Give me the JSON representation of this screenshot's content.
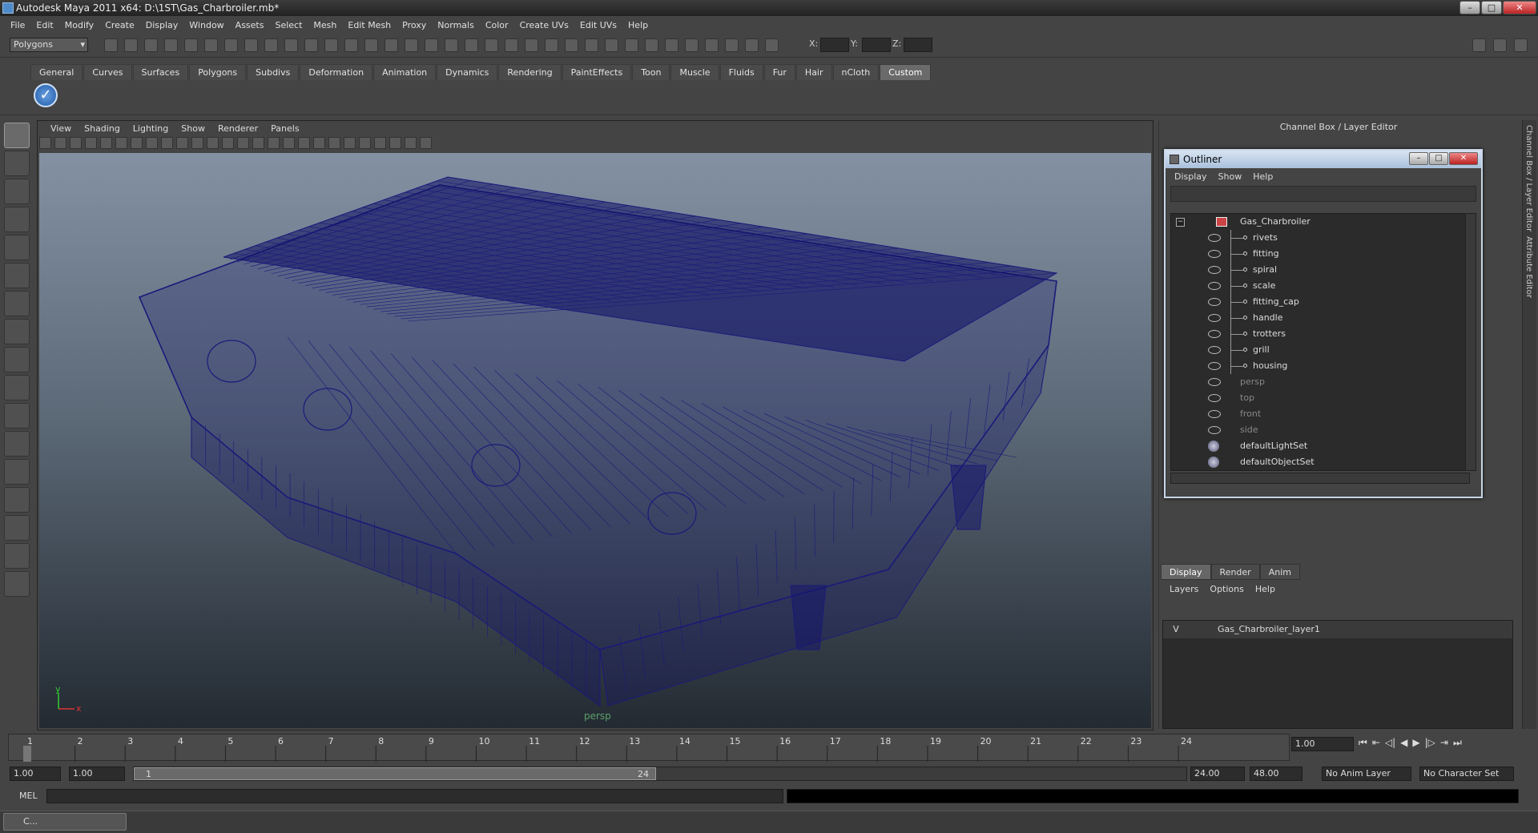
{
  "window": {
    "title": "Autodesk Maya 2011 x64: D:\\1ST\\Gas_Charbroiler.mb*"
  },
  "menubar": [
    "File",
    "Edit",
    "Modify",
    "Create",
    "Display",
    "Window",
    "Assets",
    "Select",
    "Mesh",
    "Edit Mesh",
    "Proxy",
    "Normals",
    "Color",
    "Create UVs",
    "Edit UVs",
    "Help"
  ],
  "statusline": {
    "mode": "Polygons",
    "x_label": "X:",
    "y_label": "Y:",
    "z_label": "Z:"
  },
  "shelf": {
    "tabs": [
      "General",
      "Curves",
      "Surfaces",
      "Polygons",
      "Subdivs",
      "Deformation",
      "Animation",
      "Dynamics",
      "Rendering",
      "PaintEffects",
      "Toon",
      "Muscle",
      "Fluids",
      "Fur",
      "Hair",
      "nCloth",
      "Custom"
    ],
    "active": "Custom"
  },
  "viewport": {
    "menus": [
      "View",
      "Shading",
      "Lighting",
      "Show",
      "Renderer",
      "Panels"
    ],
    "camera_label": "persp",
    "axis_x": "x",
    "axis_y": "y",
    "wire_color": "#1a1a7a"
  },
  "right_panel": {
    "title": "Channel Box / Layer Editor",
    "side_tabs": [
      "Channel Box / Layer Editor",
      "Attribute Editor"
    ]
  },
  "outliner": {
    "title": "Outliner",
    "menus": [
      "Display",
      "Show",
      "Help"
    ],
    "collapse_symbol": "−",
    "root": "Gas_Charbroiler",
    "children": [
      "rivets",
      "fitting",
      "spiral",
      "scale",
      "fitting_cap",
      "handle",
      "trotters",
      "grill",
      "housing"
    ],
    "cameras": [
      "persp",
      "top",
      "front",
      "side"
    ],
    "sets": [
      "defaultLightSet",
      "defaultObjectSet"
    ]
  },
  "layer_editor": {
    "tabs": [
      "Display",
      "Render",
      "Anim"
    ],
    "active": "Display",
    "menus": [
      "Layers",
      "Options",
      "Help"
    ],
    "layer": {
      "visible": "V",
      "name": "Gas_Charbroiler_layer1"
    }
  },
  "timeline": {
    "start": 1,
    "end": 24,
    "current_frame": "1.00"
  },
  "range": {
    "start_min": "1.00",
    "start": "1.00",
    "slider_start": "1",
    "slider_end": "24",
    "end": "24.00",
    "end_max": "48.00",
    "anim_layer": "No Anim Layer",
    "char_set": "No Character Set"
  },
  "cmdline": {
    "label": "MEL"
  },
  "taskbar": {
    "item": "C..."
  }
}
